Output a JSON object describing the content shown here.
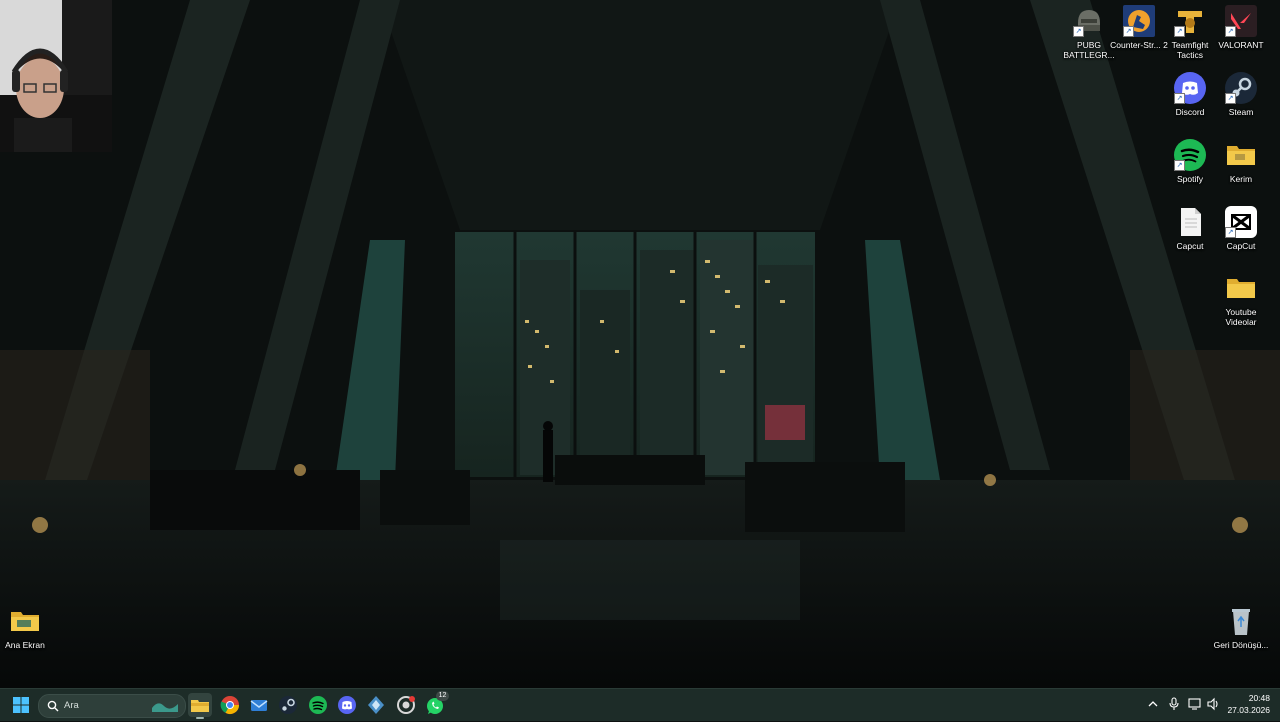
{
  "desktop": {
    "icons_right": [
      {
        "id": "pubg",
        "label": "PUBG BATTLEGR..."
      },
      {
        "id": "cs2",
        "label": "Counter-Str... 2"
      },
      {
        "id": "tft",
        "label": "Teamfight Tactics"
      },
      {
        "id": "valorant",
        "label": "VALORANT"
      },
      {
        "id": "discord",
        "label": "Discord"
      },
      {
        "id": "steam",
        "label": "Steam"
      },
      {
        "id": "spotify",
        "label": "Spotify"
      },
      {
        "id": "kerim",
        "label": "Kerim"
      },
      {
        "id": "capcut_file",
        "label": "Capcut"
      },
      {
        "id": "capcut",
        "label": "CapCut"
      },
      {
        "id": "youtube",
        "label": "Youtube Videolar"
      }
    ],
    "icon_ana_ekran": {
      "label": "Ana Ekran"
    },
    "icon_recycle": {
      "label": "Geri Dönüşü..."
    }
  },
  "taskbar": {
    "search_placeholder": "Ara",
    "apps": [
      {
        "name": "file-explorer-icon"
      },
      {
        "name": "chrome-icon"
      },
      {
        "name": "mail-icon"
      },
      {
        "name": "steam-icon"
      },
      {
        "name": "spotify-icon"
      },
      {
        "name": "discord-icon"
      },
      {
        "name": "bluetooth-app-icon"
      },
      {
        "name": "record-app-icon"
      },
      {
        "name": "whatsapp-icon"
      }
    ],
    "whatsapp_badge": "12",
    "time": "20:48",
    "date": "27.03.2026"
  },
  "colors": {
    "taskbar_bg": "#1d2c28",
    "discord": "#5865F2",
    "spotify": "#1DB954",
    "valorant": "#ff4655",
    "folder": "#f3c94a"
  }
}
